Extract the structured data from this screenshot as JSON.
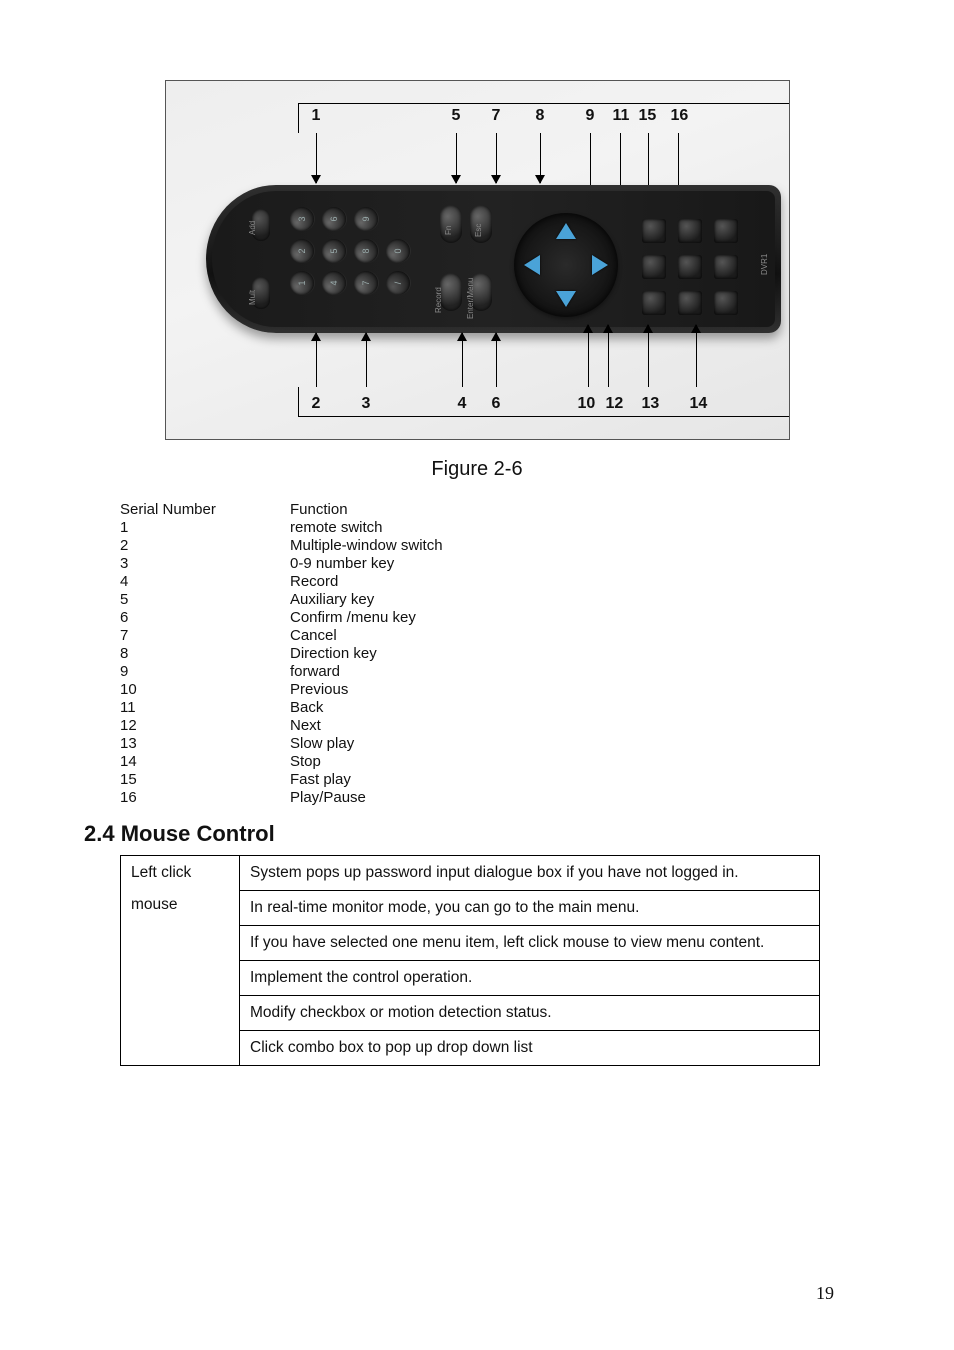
{
  "figure": {
    "caption": "Figure 2-6",
    "top_labels": [
      "1",
      "5",
      "7",
      "8",
      "9",
      "11",
      "15",
      "16"
    ],
    "bottom_labels": [
      "2",
      "3",
      "4",
      "6",
      "10",
      "12",
      "13",
      "14"
    ],
    "keypad_numbers": [
      "1",
      "2",
      "3",
      "4",
      "5",
      "6",
      "7",
      "8",
      "9",
      "0"
    ],
    "side_labels": {
      "add": "Add",
      "mult": "Mult",
      "fn": "Fn",
      "esc": "Esc",
      "record": "Record",
      "enter": "Enter/Menu",
      "dvr": "DVR1"
    }
  },
  "functions_header": {
    "col1": "Serial Number",
    "col2": "Function"
  },
  "functions": [
    {
      "n": "1",
      "f": "remote switch"
    },
    {
      "n": "2",
      "f": "Multiple-window switch"
    },
    {
      "n": "3",
      "f": "0-9 number key"
    },
    {
      "n": "4",
      "f": "Record"
    },
    {
      "n": "5",
      "f": "Auxiliary  key"
    },
    {
      "n": "6",
      "f": "Confirm /menu key"
    },
    {
      "n": "7",
      "f": "Cancel"
    },
    {
      "n": "8",
      "f": "Direction key"
    },
    {
      "n": "9",
      "f": "forward"
    },
    {
      "n": "10",
      "f": "Previous"
    },
    {
      "n": "11",
      "f": "Back"
    },
    {
      "n": "12",
      "f": "Next"
    },
    {
      "n": "13",
      "f": "Slow play"
    },
    {
      "n": "14",
      "f": "Stop"
    },
    {
      "n": "15",
      "f": "Fast play"
    },
    {
      "n": "16",
      "f": "Play/Pause"
    }
  ],
  "section_heading": "2.4  Mouse Control",
  "mouse_table": {
    "left_col": [
      "Left click",
      "mouse"
    ],
    "rows": [
      "System pops up password input dialogue box if you have not logged in.",
      "In real-time monitor mode, you can go to the main menu.",
      "If you have selected one menu item, left click mouse to view menu content.",
      "Implement the control operation.",
      "Modify checkbox or motion detection status.",
      "Click combo box to pop up drop down list"
    ]
  },
  "page_number": "19"
}
